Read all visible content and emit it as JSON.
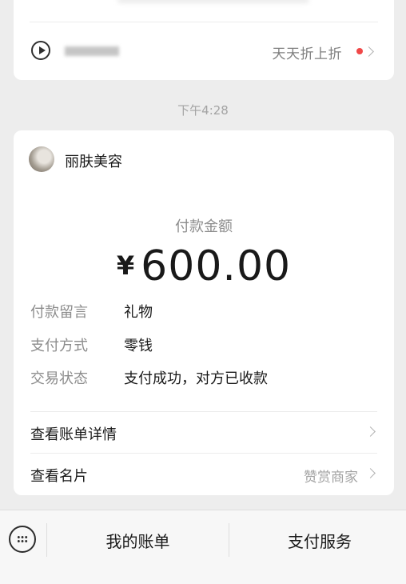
{
  "top_card": {
    "promo_text": "天天折上折"
  },
  "timestamp": "下午4:28",
  "payment": {
    "merchant_name": "丽肤美容",
    "amount_label": "付款金额",
    "currency_symbol": "¥",
    "amount": "600.00",
    "details": [
      {
        "label": "付款留言",
        "value": "礼物"
      },
      {
        "label": "支付方式",
        "value": "零钱"
      },
      {
        "label": "交易状态",
        "value": "支付成功，对方已收款"
      }
    ],
    "links": [
      {
        "label": "查看账单详情",
        "right_text": ""
      },
      {
        "label": "查看名片",
        "right_text": "赞赏商家"
      }
    ]
  },
  "bottom_bar": {
    "buttons": [
      "我的账单",
      "支付服务"
    ]
  },
  "colors": {
    "background": "#ededed",
    "card": "#ffffff",
    "red_dot": "#f04848"
  }
}
